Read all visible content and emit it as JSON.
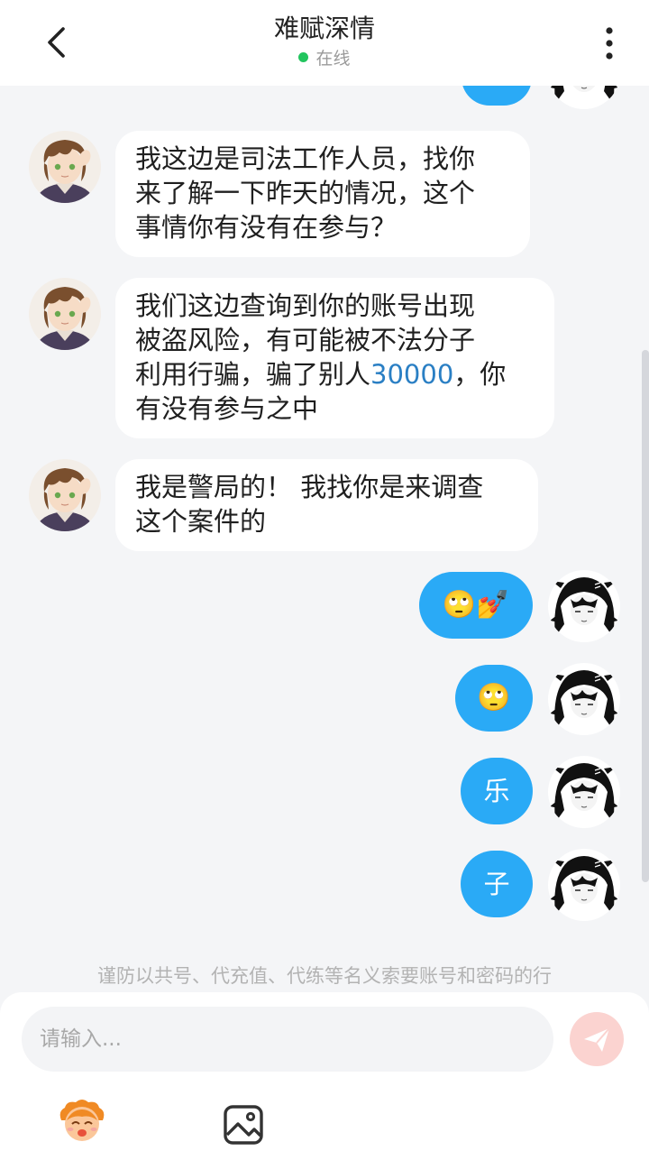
{
  "header": {
    "title": "难赋深情",
    "status": "在线",
    "status_color": "#22c55e",
    "back_icon": "chevron-left-icon",
    "more_icon": "more-vertical-icon"
  },
  "messages": [
    {
      "direction": "in",
      "lines": [
        "我这边是司法工作人员，找你",
        "来了解一下昨天的情况，这个",
        "事情你有没有在参与？"
      ]
    },
    {
      "direction": "in",
      "lines": [
        "我们这边查询到你的账号出现",
        "被盗风险，有可能被不法分子"
      ],
      "line3_before": "利用行骗，骗了别人",
      "line3_number": "30000",
      "line3_after": "，你",
      "line4": "有没有参与之中"
    },
    {
      "direction": "in",
      "lines": [
        "我是警局的！ 我找你是来调查",
        "这个案件的"
      ]
    },
    {
      "direction": "out",
      "text": "🙄💅"
    },
    {
      "direction": "out",
      "text": "🙄"
    },
    {
      "direction": "out",
      "text": "乐"
    },
    {
      "direction": "out",
      "text": "子"
    }
  ],
  "notice": "谨防以共号、代充值、代练等名义索要账号和密码的行",
  "composer": {
    "placeholder": "请输入...",
    "send_icon": "send-icon",
    "emoji_icon": "emoji-face-icon",
    "image_icon": "image-icon"
  },
  "colors": {
    "accent": "#2aaaf6",
    "highlight_number": "#2a7fc4",
    "send_button": "#fbd3d0"
  }
}
